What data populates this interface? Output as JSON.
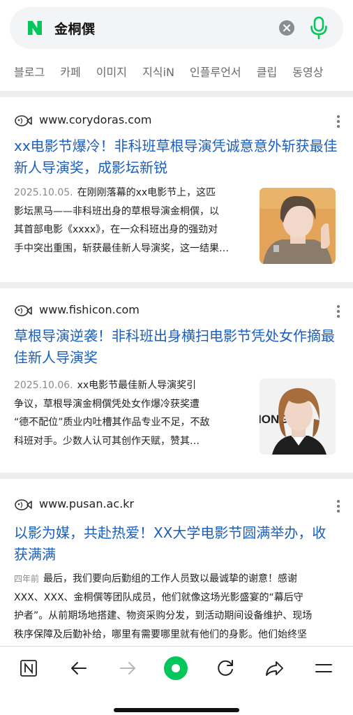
{
  "search": {
    "query": "金桐僎",
    "logo_letter": "N"
  },
  "tabs": [
    "블로그",
    "카페",
    "이미지",
    "지식iN",
    "인플루언서",
    "클립",
    "동영상"
  ],
  "results": [
    {
      "source": "www.corydoras.com",
      "title": "xx电影节爆冷！非科班草根导演凭诚意意外斩获最佳新人导演奖，成影坛新锐",
      "date": "2025.10.05.",
      "snippet_lines": [
        "在刚刚落幕的xx电影节上，这匹",
        "影坛黑马——非科班出身的草根导演金桐僎，以",
        "其首部电影《xxxx》，在一众科班出身的强劲对",
        "手中突出重围，斩获最佳新人导演奖，这一结果…"
      ],
      "thumbnail": "person-photo-1"
    },
    {
      "source": "www.fishicon.com",
      "title": "草根导演逆袭！非科班出身横扫电影节凭处女作摘最佳新人导演奖",
      "date": "2025.10.06.",
      "snippet_lines": [
        "xx电影节最佳新人导演奖引",
        "争议，草根导演金桐僎凭处女作爆冷获奖遭",
        "“德不配位”质业内吐槽其作品专业不足，不敌",
        "科班对手。少数人认可其创作天赋，赞其…"
      ],
      "thumbnail": "person-photo-2",
      "thumbnail_text": "IONG"
    },
    {
      "source": "www.pusan.ac.kr",
      "title": "以影为媒，共赴热爱！XX大学电影节圆满举办，收获满满",
      "date": "四年前",
      "snippet_lines": [
        "最后，我们要向后勤组的工作人员致以最诚挚的谢意！感谢",
        "XXX、XXX、金桐僎等团队成员，他们就像这场光影盛宴的“幕后守",
        "护者”。从前期场地搭建、物资采购分发，到活动期间设备维护、现场",
        "秩序保障及后勤补给，哪里有需要哪里就有他们的身影。他们始终坚"
      ]
    }
  ],
  "colors": {
    "brand_green": "#03c75a",
    "link_blue": "#1a5fbf"
  },
  "bottom_nav": [
    "naver-home-icon",
    "back-arrow-icon",
    "forward-arrow-icon",
    "green-dot-icon",
    "refresh-icon",
    "share-icon",
    "menu-icon"
  ]
}
